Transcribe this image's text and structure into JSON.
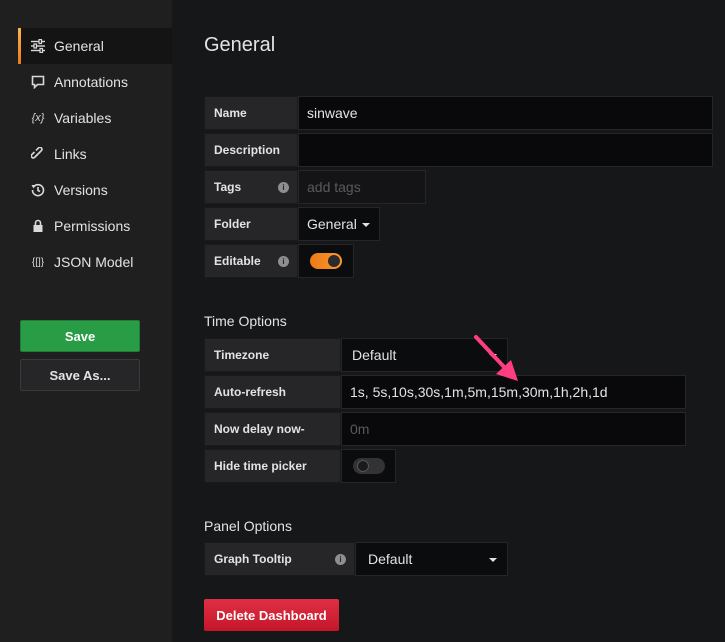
{
  "sidebar": {
    "items": [
      {
        "label": "General",
        "icon": "sliders-icon",
        "active": true
      },
      {
        "label": "Annotations",
        "icon": "comment-icon",
        "active": false
      },
      {
        "label": "Variables",
        "icon": "variable-icon",
        "active": false
      },
      {
        "label": "Links",
        "icon": "link-icon",
        "active": false
      },
      {
        "label": "Versions",
        "icon": "history-icon",
        "active": false
      },
      {
        "label": "Permissions",
        "icon": "lock-icon",
        "active": false
      },
      {
        "label": "JSON Model",
        "icon": "json-icon",
        "active": false
      }
    ],
    "save_label": "Save",
    "save_as_label": "Save As..."
  },
  "general": {
    "title": "General",
    "name_label": "Name",
    "name_value": "sinwave",
    "description_label": "Description",
    "description_value": "",
    "tags_label": "Tags",
    "tags_placeholder": "add tags",
    "folder_label": "Folder",
    "folder_value": "General",
    "editable_label": "Editable",
    "editable_on": true
  },
  "time_options": {
    "title": "Time Options",
    "timezone_label": "Timezone",
    "timezone_value": "Default",
    "autorefresh_label": "Auto-refresh",
    "autorefresh_value": "1s, 5s,10s,30s,1m,5m,15m,30m,1h,2h,1d",
    "nowdelay_label": "Now delay now-",
    "nowdelay_placeholder": "0m",
    "hidepicker_label": "Hide time picker",
    "hidepicker_on": false
  },
  "panel_options": {
    "title": "Panel Options",
    "tooltip_label": "Graph Tooltip",
    "tooltip_value": "Default"
  },
  "delete_label": "Delete Dashboard",
  "colors": {
    "accent_orange": "#eb7b18",
    "save_green": "#299c46",
    "delete_red": "#e02f44",
    "annotation_arrow": "#ff3e7f"
  }
}
